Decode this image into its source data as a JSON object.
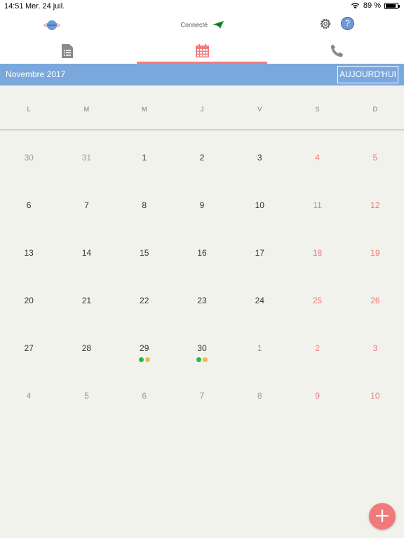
{
  "status": {
    "time": "14:51",
    "date": "Mer. 24 juil.",
    "battery_label": "89 %",
    "battery_level": 0.89
  },
  "header": {
    "connection_label": "Connecté",
    "icons": [
      "logo-icon",
      "paper-plane-icon",
      "gear-icon",
      "help-icon"
    ],
    "help_glyph": "?"
  },
  "tabs": [
    {
      "icon": "document-icon",
      "active": false
    },
    {
      "icon": "calendar-icon",
      "active": true
    },
    {
      "icon": "phone-icon",
      "active": false
    }
  ],
  "calendar": {
    "month_title": "Novembre 2017",
    "today_label": "AUJOURD'HUI",
    "weekdays": [
      "L",
      "M",
      "M",
      "J",
      "V",
      "S",
      "D"
    ],
    "weeks": [
      [
        {
          "d": "30",
          "m": true
        },
        {
          "d": "31",
          "m": true
        },
        {
          "d": "1"
        },
        {
          "d": "2"
        },
        {
          "d": "3"
        },
        {
          "d": "4",
          "w": true
        },
        {
          "d": "5",
          "w": true
        }
      ],
      [
        {
          "d": "6"
        },
        {
          "d": "7"
        },
        {
          "d": "8"
        },
        {
          "d": "9"
        },
        {
          "d": "10"
        },
        {
          "d": "11",
          "w": true
        },
        {
          "d": "12",
          "w": true
        }
      ],
      [
        {
          "d": "13"
        },
        {
          "d": "14"
        },
        {
          "d": "15"
        },
        {
          "d": "16"
        },
        {
          "d": "17"
        },
        {
          "d": "18",
          "w": true
        },
        {
          "d": "19",
          "w": true
        }
      ],
      [
        {
          "d": "20"
        },
        {
          "d": "21"
        },
        {
          "d": "22"
        },
        {
          "d": "23"
        },
        {
          "d": "24"
        },
        {
          "d": "25",
          "w": true
        },
        {
          "d": "26",
          "w": true
        }
      ],
      [
        {
          "d": "27"
        },
        {
          "d": "28"
        },
        {
          "d": "29",
          "dots": [
            "#22bb44",
            "#f2b84b"
          ]
        },
        {
          "d": "30",
          "dots": [
            "#22bb44",
            "#f2b84b"
          ]
        },
        {
          "d": "1",
          "m": true
        },
        {
          "d": "2",
          "w": true
        },
        {
          "d": "3",
          "w": true
        }
      ],
      [
        {
          "d": "4",
          "m": true
        },
        {
          "d": "5",
          "m": true
        },
        {
          "d": "6",
          "m": true
        },
        {
          "d": "7",
          "m": true
        },
        {
          "d": "8",
          "m": true
        },
        {
          "d": "9",
          "w": true
        },
        {
          "d": "10",
          "w": true
        }
      ]
    ]
  },
  "fab": {
    "glyph": "+",
    "color": "#f07a7a"
  },
  "colors": {
    "accent": "#f27b7b",
    "month_bar": "#7aa8dd",
    "weekend": "#f07a7a",
    "muted": "#9a9a9a"
  }
}
